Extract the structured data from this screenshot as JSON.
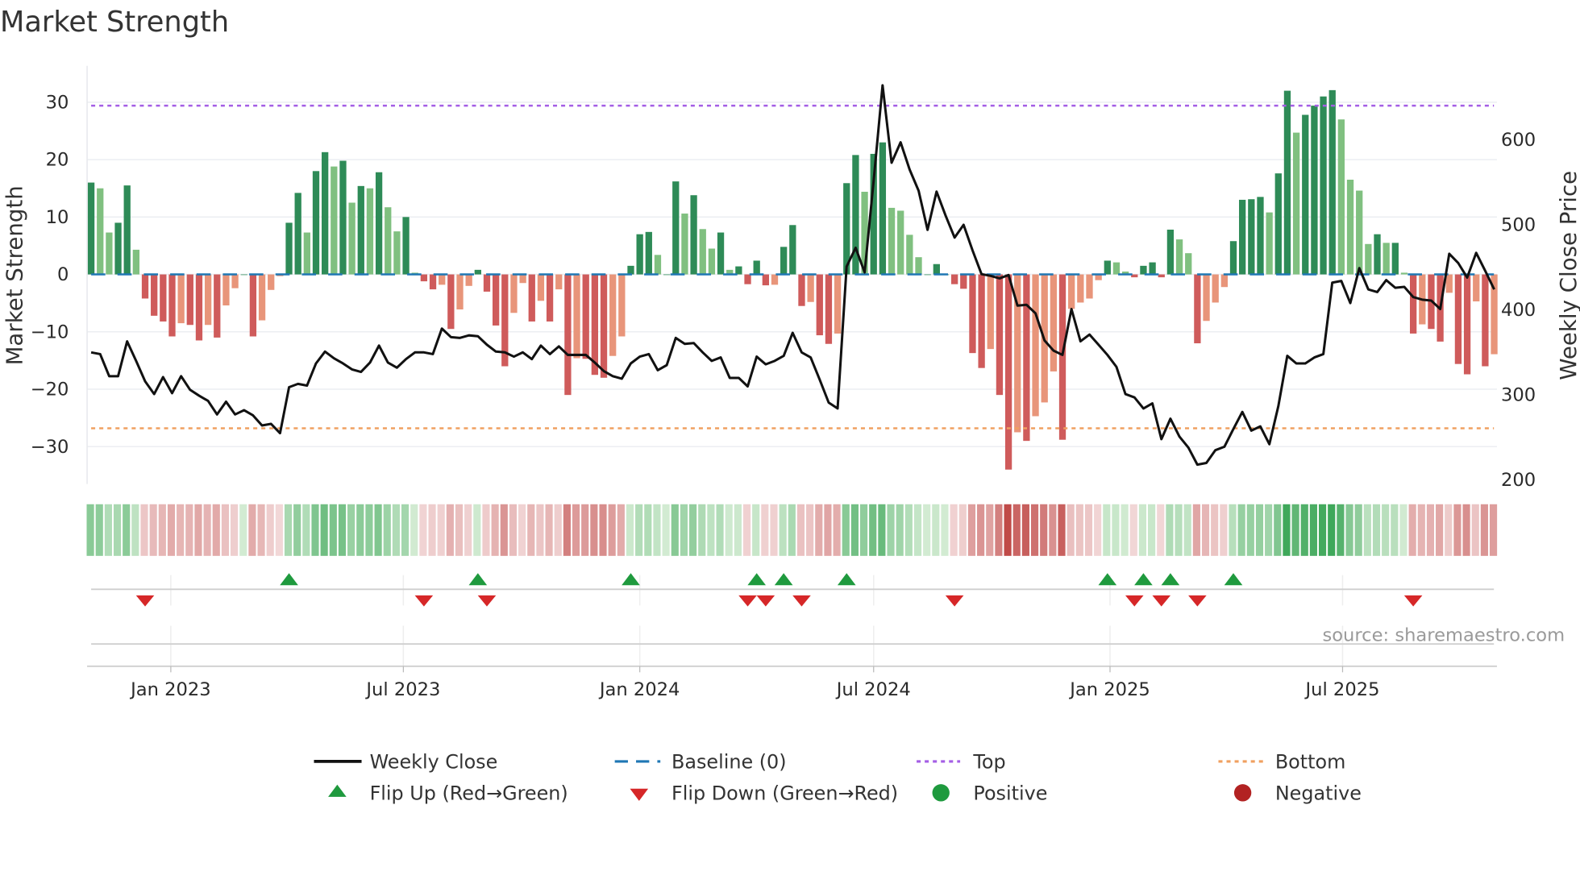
{
  "chart_data": {
    "type": "bar",
    "title": "Market Strength",
    "frequency": "weekly",
    "start_week": "2022-10-31",
    "ylabel_left": "Market Strength",
    "ylabel_right": "Weekly Close Price",
    "ylim_left": [
      -36.5,
      36.3
    ],
    "ylim_right": [
      195,
      687
    ],
    "yticks_left": [
      30,
      20,
      10,
      0,
      -10,
      -20,
      -30
    ],
    "ytick_labels_left": [
      "30",
      "20",
      "10",
      "0",
      "−10",
      "−20",
      "−30"
    ],
    "yticks_right": [
      600,
      500,
      400,
      300,
      200
    ],
    "ytick_labels_right": [
      "600",
      "500",
      "400",
      "300",
      "200"
    ],
    "xticks": [
      {
        "date": "2023-01-01",
        "label": "Jan 2023"
      },
      {
        "date": "2023-07-01",
        "label": "Jul 2023"
      },
      {
        "date": "2024-01-01",
        "label": "Jan 2024"
      },
      {
        "date": "2024-07-01",
        "label": "Jul 2024"
      },
      {
        "date": "2025-01-01",
        "label": "Jan 2025"
      },
      {
        "date": "2025-07-01",
        "label": "Jul 2025"
      }
    ],
    "grid": true,
    "top_level": 29.4,
    "bottom_level": -26.8,
    "baseline": 0,
    "strength": [
      16,
      15,
      7.3,
      9,
      15.5,
      4.3,
      -4.2,
      -7.2,
      -8.2,
      -10.8,
      -8.5,
      -8.8,
      -11.5,
      -8.8,
      -11,
      -5.4,
      -2.4,
      0,
      -10.8,
      -8,
      -2.7,
      -0.3,
      9,
      14.2,
      7.3,
      18,
      21.3,
      18.8,
      19.8,
      12.5,
      15.4,
      15,
      17.8,
      11.7,
      7.5,
      10,
      0.3,
      -1.2,
      -2.6,
      -1.8,
      -9.5,
      -6.1,
      -2,
      0.8,
      -3,
      -8.9,
      -16,
      -6.7,
      -1.5,
      -8.2,
      -4.6,
      -8.2,
      -2.6,
      -21,
      -14.6,
      -14.7,
      -17.5,
      -18,
      -14.2,
      -10.8,
      1.5,
      7,
      7.4,
      3.4,
      0,
      16.2,
      10.6,
      13.8,
      7.9,
      4.5,
      7.3,
      0.8,
      1.4,
      -1.7,
      2.4,
      -1.9,
      -1.8,
      4.8,
      8.6,
      -5.5,
      -4.8,
      -10.6,
      -12.1,
      -10.3,
      15.9,
      20.8,
      14.4,
      21,
      23,
      11.6,
      11.1,
      6.9,
      3,
      0,
      1.8,
      0,
      -1.7,
      -2.5,
      -13.7,
      -16.3,
      -13,
      -21,
      -34,
      -27.5,
      -29,
      -24.7,
      -22.3,
      -16.9,
      -28.8,
      -6,
      -4.9,
      -4.2,
      -1,
      2.4,
      2.1,
      0.5,
      -0.5,
      1.5,
      2.1,
      -0.5,
      7.8,
      6.1,
      3.7,
      -12,
      -8.1,
      -4.9,
      -2.2,
      5.8,
      13,
      13.1,
      13.5,
      10.8,
      17.6,
      32,
      24.7,
      27.8,
      29.4,
      31,
      32.1,
      27,
      16.5,
      14.6,
      5.3,
      7,
      5.5,
      5.5,
      0.3,
      -10.3,
      -8.7,
      -9.5,
      -11.7,
      -3.2,
      -15.6,
      -17.4,
      -4.7,
      -16,
      -13.9
    ],
    "weekly_close": [
      350,
      348,
      322,
      322,
      363,
      340,
      316,
      301,
      321,
      302,
      322,
      306,
      299,
      293,
      277,
      292,
      277,
      282,
      276,
      264,
      266,
      255,
      309,
      313,
      311,
      337,
      351,
      343,
      337,
      330,
      327,
      338,
      358,
      338,
      332,
      342,
      350,
      350,
      348,
      378,
      368,
      367,
      370,
      369,
      359,
      351,
      350,
      345,
      350,
      342,
      358,
      348,
      357,
      347,
      347,
      347,
      338,
      328,
      322,
      319,
      337,
      345,
      348,
      329,
      335,
      367,
      360,
      361,
      350,
      340,
      344,
      320,
      320,
      310,
      345,
      336,
      340,
      346,
      373,
      350,
      344,
      318,
      291,
      284,
      451,
      473,
      444,
      552,
      664,
      573,
      597,
      565,
      540,
      494,
      539,
      511,
      485,
      500,
      470,
      442,
      440,
      437,
      441,
      405,
      406,
      396,
      364,
      352,
      347,
      401,
      363,
      371,
      359,
      347,
      333,
      301,
      297,
      284,
      290,
      248,
      272,
      251,
      238,
      218,
      220,
      235,
      239,
      260,
      280,
      258,
      263,
      242,
      287,
      346,
      337,
      337,
      344,
      348,
      432,
      434,
      408,
      449,
      424,
      421,
      435,
      426,
      427,
      415,
      412,
      411,
      401,
      466,
      455,
      438,
      467,
      446,
      424
    ],
    "flip_up_weeks": [
      22,
      43,
      60,
      74,
      77,
      84,
      113,
      117,
      120,
      127
    ],
    "flip_down_weeks": [
      6,
      37,
      44,
      73,
      75,
      79,
      96,
      116,
      119,
      123,
      147
    ],
    "colors": {
      "strong_positive": "#2e8b57",
      "weak_positive": "#80c080",
      "strong_negative": "#cf5b5b",
      "weak_negative": "#e8957a",
      "close_line": "#111111",
      "baseline": "#1f77b4",
      "top": "#a45ee5",
      "bottom": "#f0a060",
      "flip_up": "#1f9a3e",
      "flip_down": "#d62728",
      "positive": "#1f9a3e",
      "negative": "#b22222"
    },
    "legend": {
      "placement": "bottom",
      "weekly_close": "Weekly Close",
      "baseline": "Baseline (0)",
      "top": "Top",
      "bottom": "Bottom",
      "flip_up": "Flip Up (Red→Green)",
      "flip_down": "Flip Down (Green→Red)",
      "positive": "Positive",
      "negative": "Negative"
    },
    "source": "source: sharemaestro.com"
  }
}
